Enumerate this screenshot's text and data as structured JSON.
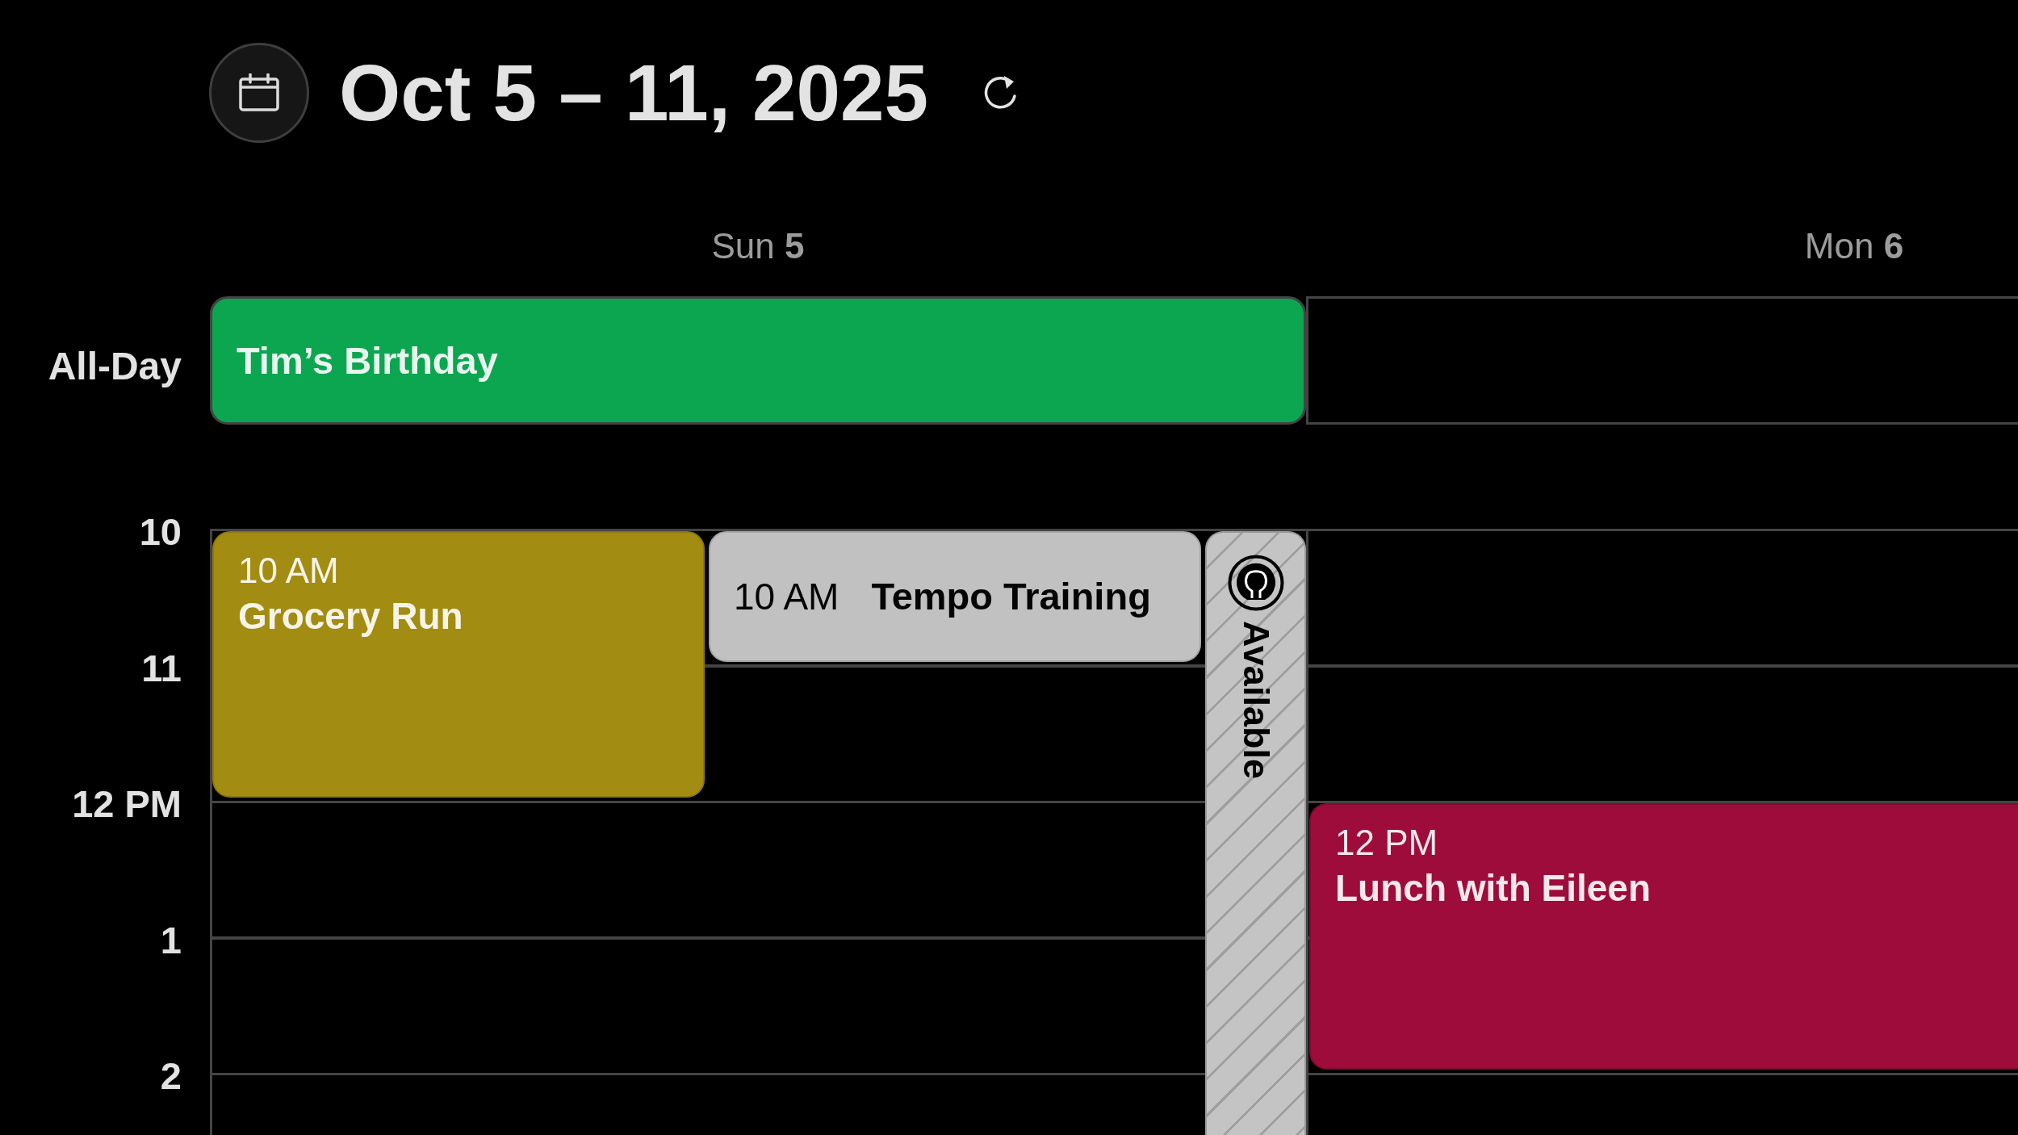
{
  "header": {
    "title": "Oct 5 – 11, 2025"
  },
  "all_day_label": "All-Day",
  "hours": [
    "10",
    "11",
    "12 PM",
    "1",
    "2"
  ],
  "days": [
    {
      "label": "Sun **5**",
      "all_day": [
        {
          "title": "Tim’s Birthday",
          "color": "#0ca550"
        }
      ],
      "events": [
        {
          "kind": "timed",
          "time": "10 AM",
          "title": "Grocery Run",
          "color": "#a38c12"
        },
        {
          "kind": "compact",
          "time": "10 AM",
          "title": "Tempo Training",
          "color": "#c1c1c1"
        },
        {
          "kind": "availability",
          "title": "Available"
        }
      ]
    },
    {
      "label": "Mon **6**",
      "events": [
        {
          "kind": "timed",
          "time": "12 PM",
          "title": "Lunch with Eileen",
          "color": "#9e0c3b"
        }
      ]
    }
  ]
}
